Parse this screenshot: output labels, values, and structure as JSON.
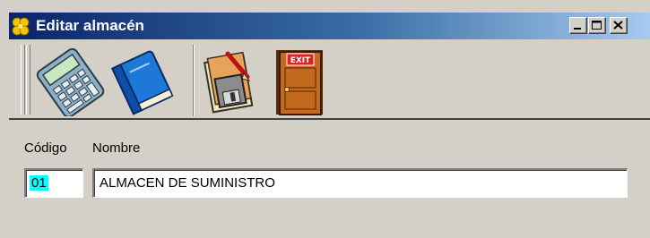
{
  "window": {
    "title": "Editar almacén",
    "controls": [
      "minimize-icon",
      "maximize-icon",
      "close-icon"
    ]
  },
  "toolbar": {
    "items": [
      {
        "icon": "calculator-icon"
      },
      {
        "icon": "book-icon"
      },
      {
        "icon": "save-icon"
      },
      {
        "icon": "exit-door-icon",
        "badge": "EXIT"
      }
    ]
  },
  "form": {
    "codigo_label": "Código",
    "nombre_label": "Nombre",
    "codigo_value": "01",
    "nombre_value": "ALMACEN DE SUMINISTRO"
  },
  "colors": {
    "titlebar_start": "#0a246a",
    "titlebar_end": "#a6caf0",
    "face": "#d4d0c8",
    "selection": "#00ffff"
  }
}
